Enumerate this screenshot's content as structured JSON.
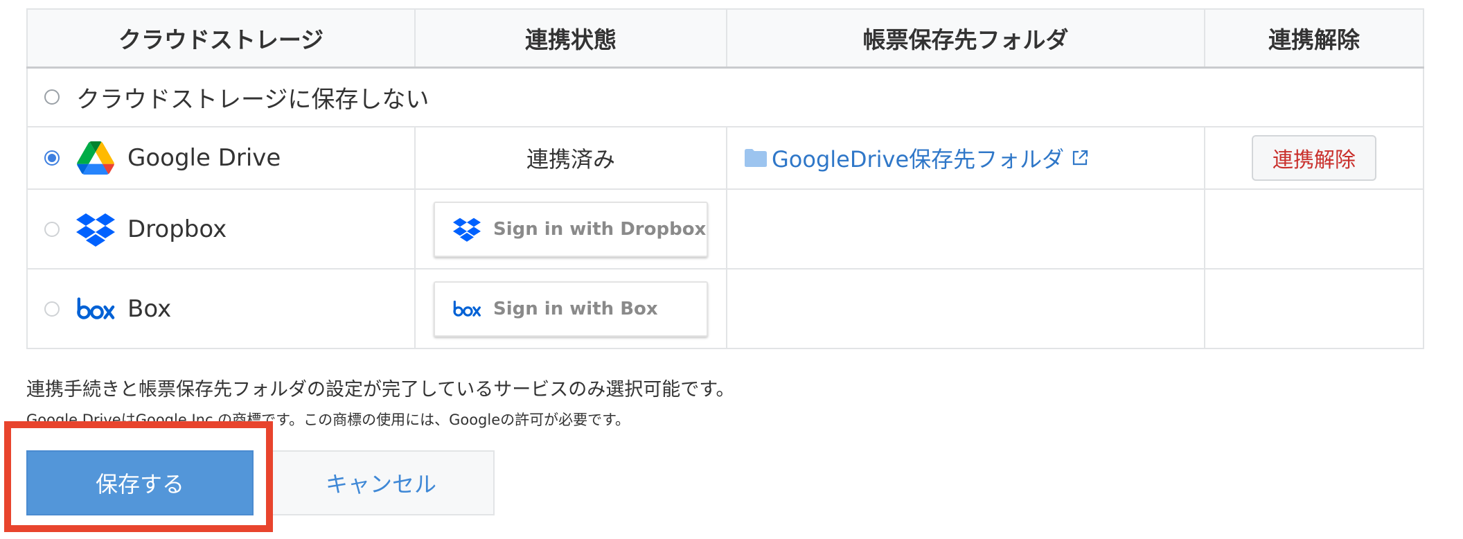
{
  "table": {
    "headers": {
      "service": "クラウドストレージ",
      "status": "連携状態",
      "folder": "帳票保存先フォルダ",
      "unlink": "連携解除"
    },
    "rows": {
      "none": {
        "label": "クラウドストレージに保存しない",
        "selected": false
      },
      "gdrive": {
        "label": "Google Drive",
        "selected": true,
        "status": "連携済み",
        "folder_link": "GoogleDrive保存先フォルダ",
        "unlink_label": "連携解除",
        "icon": "google-drive-icon"
      },
      "dropbox": {
        "label": "Dropbox",
        "selected": false,
        "signin_label": "Sign in with Dropbox",
        "icon": "dropbox-icon"
      },
      "box": {
        "label": "Box",
        "selected": false,
        "signin_label": "Sign in with Box",
        "icon": "box-icon"
      }
    }
  },
  "notes": {
    "main": "連携手続きと帳票保存先フォルダの設定が完了しているサービスのみ選択可能です。",
    "trademark": "Google DriveはGoogle Inc.の商標です。この商標の使用には、Googleの許可が必要です。"
  },
  "actions": {
    "save_label": "保存する",
    "cancel_label": "キャンセル"
  },
  "colors": {
    "primary": "#5396d9",
    "link": "#2f77c8",
    "danger": "#c9302c",
    "highlight": "#e8442d",
    "dropbox_blue": "#0061fe",
    "box_blue": "#0061d5"
  }
}
